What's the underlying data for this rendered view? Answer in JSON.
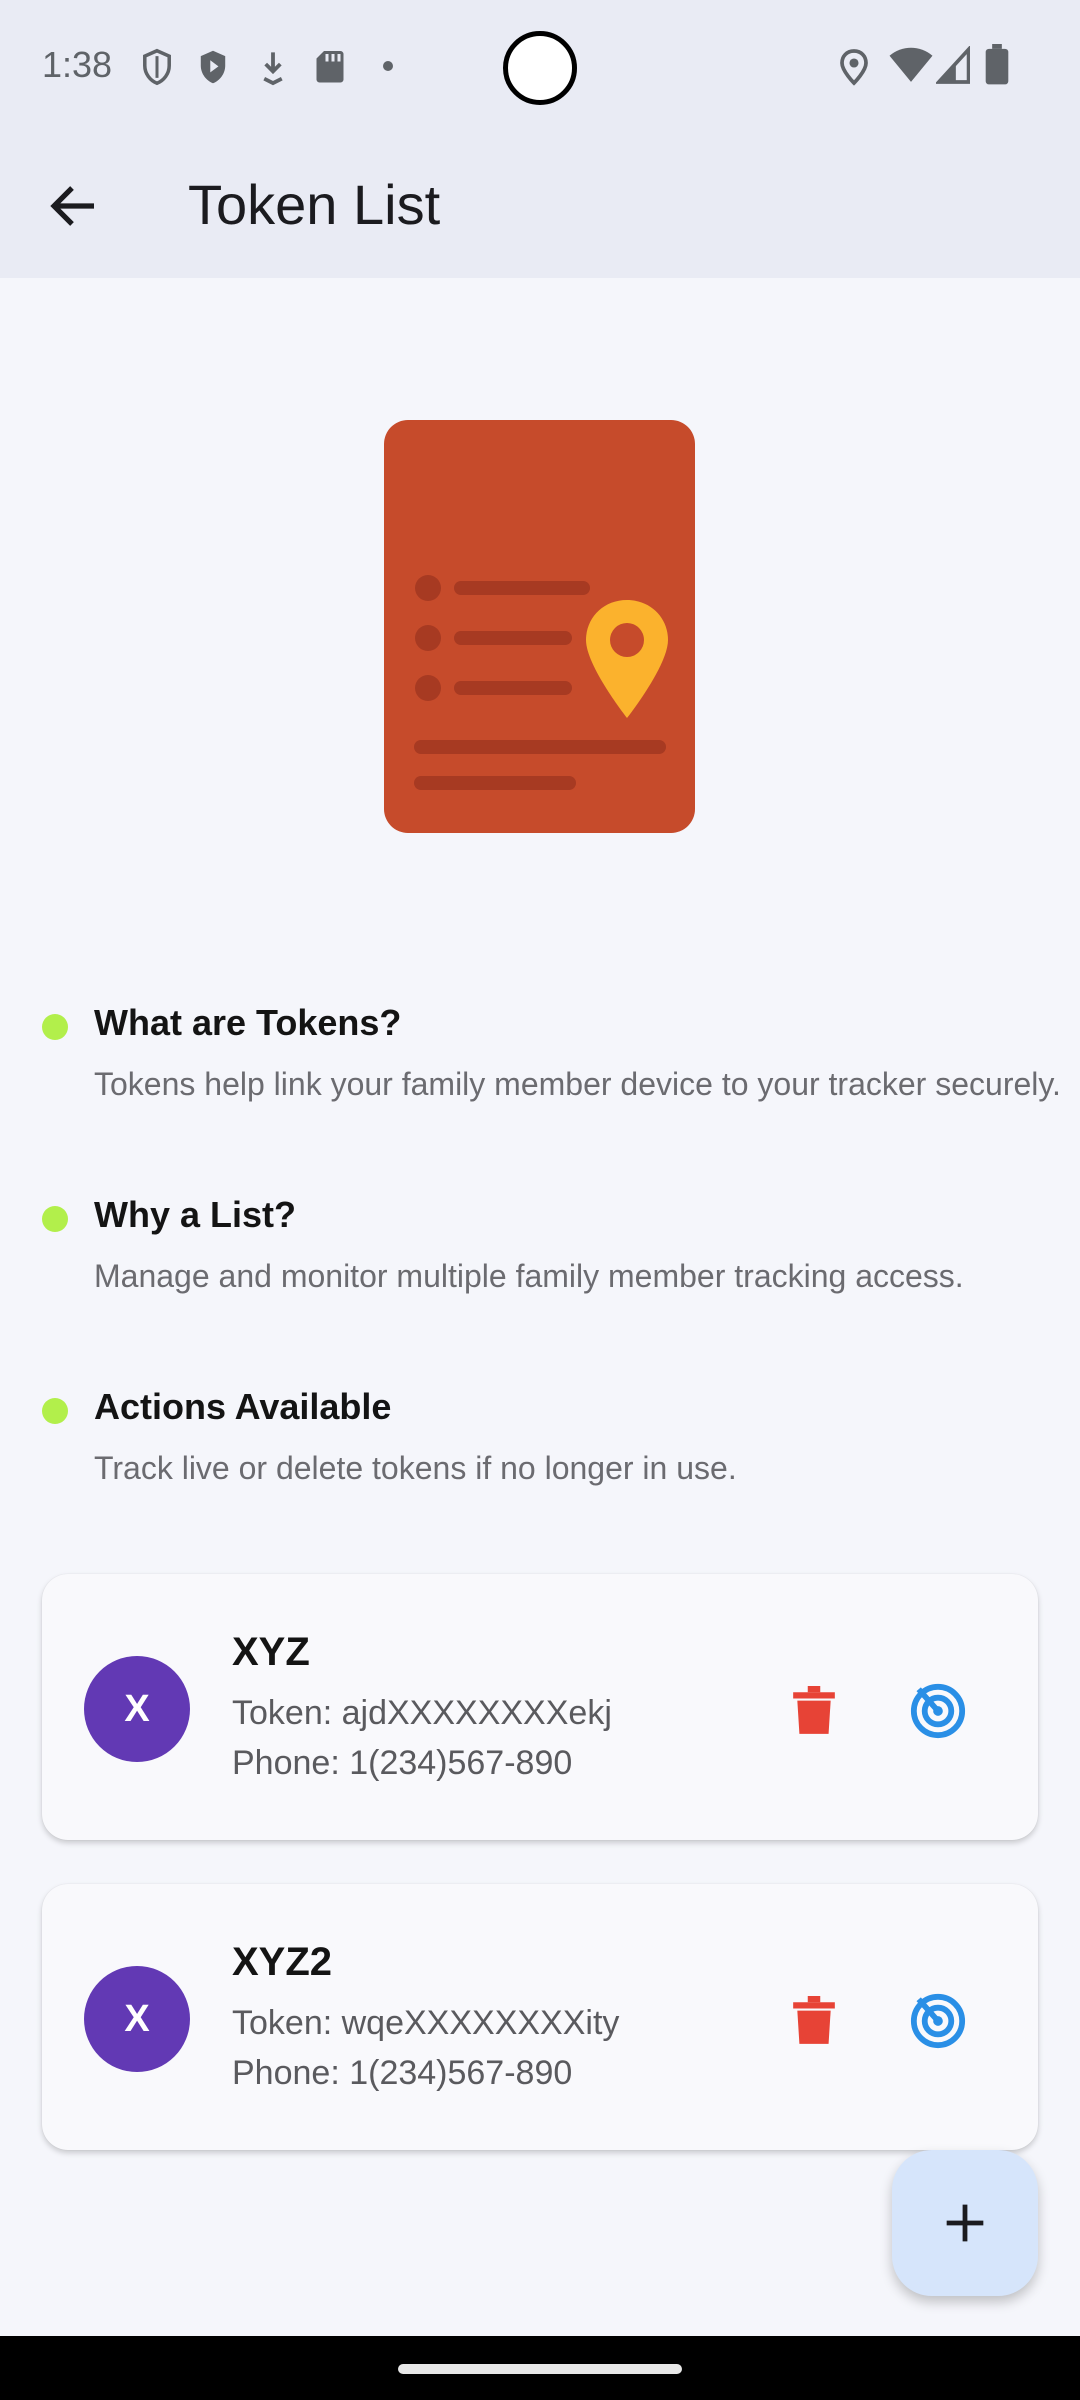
{
  "status_bar": {
    "time": "1:38",
    "icons": [
      "shield-outline-icon",
      "shield-play-icon",
      "download-icon",
      "sd-card-icon",
      "dot-icon",
      "location-icon",
      "wifi-icon",
      "cell-signal-icon",
      "battery-icon"
    ]
  },
  "app_bar": {
    "title": "Token List",
    "back_icon": "arrow-back-icon"
  },
  "illustration": {
    "icon": "document-location-icon",
    "colors": {
      "document": "#C64B2B",
      "lines": "#A73A22",
      "pin": "#FBB22D"
    }
  },
  "info": [
    {
      "title": "What are Tokens?",
      "text": "Tokens help link your family member device to your tracker securely."
    },
    {
      "title": "Why a List?",
      "text": "Manage and monitor multiple family member tracking access."
    },
    {
      "title": "Actions Available",
      "text": "Track live or delete tokens if no longer in use."
    }
  ],
  "tokens": [
    {
      "avatar": "X",
      "name": "XYZ",
      "token": "Token: ajdXXXXXXXXekj",
      "phone": "Phone: 1(234)567-890"
    },
    {
      "avatar": "X",
      "name": "XYZ2",
      "token": "Token: wqeXXXXXXXXity",
      "phone": "Phone: 1(234)567-890"
    }
  ],
  "fab": {
    "icon": "plus-icon"
  },
  "colors": {
    "accent_dot": "#B2EF4B",
    "avatar": "#6239B4",
    "delete": "#E74336",
    "track": "#2A8FE6",
    "fab": "#D6E5FB"
  }
}
